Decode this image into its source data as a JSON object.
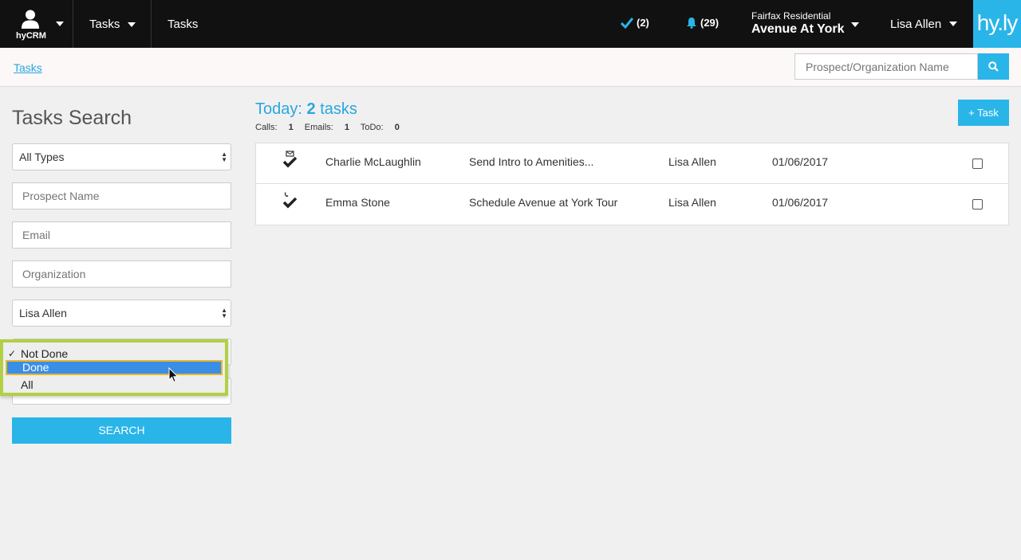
{
  "topbar": {
    "brand_label": "hyCRM",
    "tasks_menu_label": "Tasks",
    "tasks_link_label": "Tasks",
    "checks_count": "(2)",
    "notifications_count": "(29)",
    "property_company": "Fairfax Residential",
    "property_name": "Avenue At York",
    "user_name": "Lisa Allen",
    "logo_text": "hy.ly"
  },
  "breadcrumb": {
    "label": "Tasks"
  },
  "header_search": {
    "placeholder": "Prospect/Organization Name"
  },
  "sidebar": {
    "title": "Tasks Search",
    "type_select": "All Types",
    "prospect_placeholder": "Prospect Name",
    "email_placeholder": "Email",
    "organization_placeholder": "Organization",
    "assignee_select": "Lisa Allen",
    "status_options": [
      "Not Done",
      "Done",
      "All"
    ],
    "status_selected": "Not Done",
    "status_highlighted": "Done",
    "search_button": "SEARCH"
  },
  "main": {
    "today_prefix": "Today:",
    "today_count": "2",
    "today_suffix": "tasks",
    "counts": [
      {
        "label": "Calls:",
        "value": "1"
      },
      {
        "label": "Emails:",
        "value": "1"
      },
      {
        "label": "ToDo:",
        "value": "0"
      }
    ],
    "add_task_label": "+ Task",
    "tasks": [
      {
        "icon": "email-check-icon",
        "prospect": "Charlie McLaughlin",
        "subject": "Send Intro to Amenities...",
        "assignee": "Lisa Allen",
        "date": "01/06/2017"
      },
      {
        "icon": "phone-check-icon",
        "prospect": "Emma Stone",
        "subject": "Schedule Avenue at York Tour",
        "assignee": "Lisa Allen",
        "date": "01/06/2017"
      }
    ]
  },
  "colors": {
    "accent": "#29b5e8",
    "topbar": "#111111",
    "highlight_border": "#b2d045",
    "selected_option": "#3a8ee6"
  }
}
